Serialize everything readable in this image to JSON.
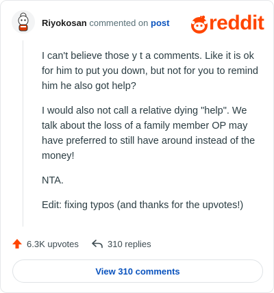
{
  "header": {
    "username": "Riyokosan",
    "action_text": "commented on",
    "post_link": "post",
    "logo_text": "reddit"
  },
  "comment": {
    "paragraphs": [
      "I can't believe those y t a comments. Like it is ok for him to put you down, but not for you to remind him he also got help?",
      "I would also not call a relative dying \"help\". We talk about the loss of a family member OP may have preferred to still have around instead of the money!",
      "NTA.",
      "Edit: fixing typos (and thanks for the upvotes!)"
    ]
  },
  "actions": {
    "upvotes_label": "6.3K upvotes",
    "replies_label": "310 replies"
  },
  "footer": {
    "view_comments_label": "View 310 comments"
  },
  "colors": {
    "brand": "#ff4500",
    "link": "#0a53be",
    "text": "#2a3c42",
    "muted": "#576f76"
  }
}
